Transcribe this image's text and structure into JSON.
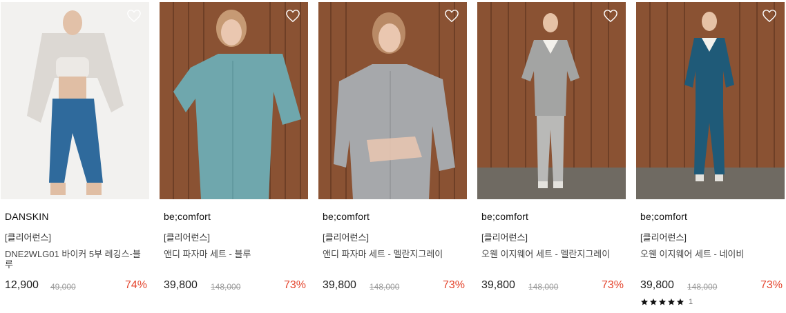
{
  "products": [
    {
      "brand": "DANSKIN",
      "tag": "[클리어런스]",
      "name": "DNE2WLG01 바이커 5부 레깅스-블루",
      "price": "12,900",
      "original_price": "49,000",
      "discount": "74%",
      "colors": {
        "bg": "#f2f1ef",
        "top": "#e6e3df",
        "bottom": "#2f6a9c"
      }
    },
    {
      "brand": "be;comfort",
      "tag": "[클리어런스]",
      "name": "앤디 파자마 세트 - 블루",
      "price": "39,800",
      "original_price": "148,000",
      "discount": "73%",
      "colors": {
        "bg": "#8a5233",
        "top": "#6fa7ad",
        "bottom": "#6fa7ad"
      }
    },
    {
      "brand": "be;comfort",
      "tag": "[클리어런스]",
      "name": "앤디 파자마 세트 - 멜란지그레이",
      "price": "39,800",
      "original_price": "148,000",
      "discount": "73%",
      "colors": {
        "bg": "#8a5233",
        "top": "#a6a8ab",
        "bottom": "#a6a8ab"
      }
    },
    {
      "brand": "be;comfort",
      "tag": "[클리어런스]",
      "name": "오웬 이지웨어 세트 - 멜란지그레이",
      "price": "39,800",
      "original_price": "148,000",
      "discount": "73%",
      "colors": {
        "bg": "#8a5233",
        "top": "#a3a4a3",
        "bottom": "#b9b9b7"
      }
    },
    {
      "brand": "be;comfort",
      "tag": "[클리어런스]",
      "name": "오웬 이지웨어 세트 - 네이비",
      "price": "39,800",
      "original_price": "148,000",
      "discount": "73%",
      "rating_stars": 5,
      "review_count": "1",
      "colors": {
        "bg": "#8a5233",
        "top": "#1f5a78",
        "bottom": "#1f5a78"
      }
    }
  ],
  "theme": {
    "discount_color": "#e4452d"
  },
  "icons": {
    "wishlist": "heart-outline-icon",
    "rating": "star-icon"
  }
}
